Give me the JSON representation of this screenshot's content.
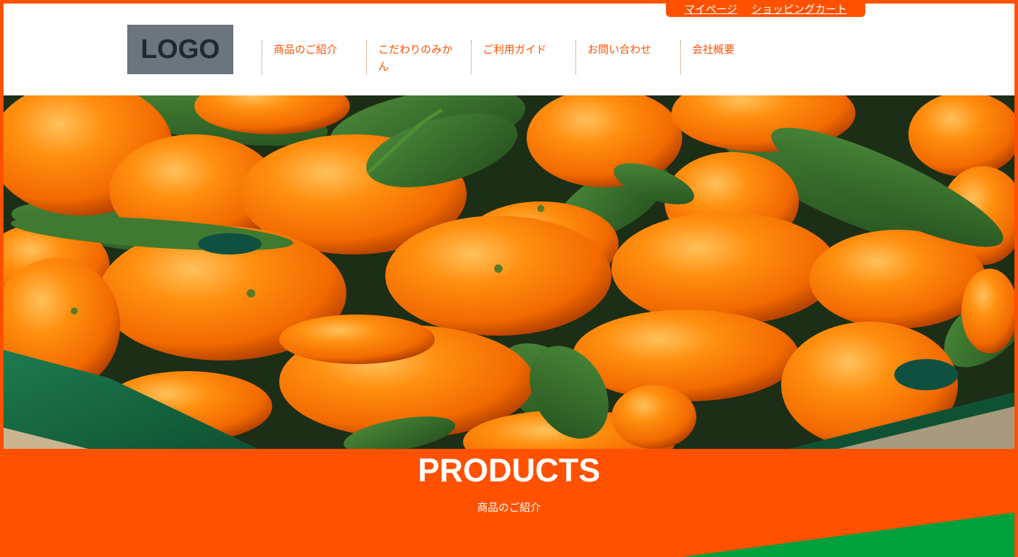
{
  "utility_links": {
    "mypage": "マイページ",
    "cart": "ショッピングカート"
  },
  "logo_text": "LOGO",
  "nav": [
    {
      "label": "商品のご紹介"
    },
    {
      "label": "こだわりのみかん"
    },
    {
      "label": "ご利用ガイド"
    },
    {
      "label": "お問い合わせ"
    },
    {
      "label": "会社概要"
    }
  ],
  "hero": {
    "image": "oranges-with-leaves-in-crate"
  },
  "products_section": {
    "title": "PRODUCTS",
    "subtitle": "商品のご紹介"
  },
  "colors": {
    "brand_orange": "#ff5100",
    "logo_bg": "#6c757d",
    "accent_green": "#00a03c",
    "white": "#ffffff"
  }
}
